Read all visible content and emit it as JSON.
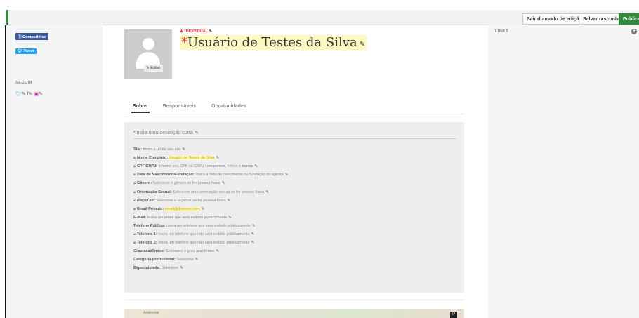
{
  "toolbar": {
    "exit_edit": "Sair do modo de edição",
    "save_draft": "Salvar rascunho",
    "publish": "Publicar"
  },
  "sidebar": {
    "share": "Compartilhar",
    "tweet": "Tweet",
    "follow_title": "SEGUIR"
  },
  "links": {
    "title": "LINKS"
  },
  "profile": {
    "type_tag": "INDIVIDUAL",
    "name": "Usuário de Testes da Silva",
    "edit_avatar": "Editar"
  },
  "tabs": [
    "Sobre",
    "Responsáveis",
    "Oportunidades"
  ],
  "description_placeholder": "Insira uma descrição curta",
  "fields": [
    {
      "label": "Site:",
      "value": "Insira a url de seu site",
      "locked": false,
      "highlight": false
    },
    {
      "label": "Nome Completo:",
      "value": "Usuário de Testes da Silva",
      "locked": true,
      "highlight": true
    },
    {
      "label": "CPF/CNPJ:",
      "value": "Informe seu CPF ou CNPJ com pontos, hífens e barras",
      "locked": true,
      "highlight": false
    },
    {
      "label": "Data de Nascimento/Fundação:",
      "value": "Insira a data de nascimento ou fundação do agente",
      "locked": true,
      "highlight": false
    },
    {
      "label": "Gênero:",
      "value": "Selecione o gênero se for pessoa física",
      "locked": true,
      "highlight": false
    },
    {
      "label": "Orientação Sexual:",
      "value": "Selecione uma orientação sexual se for pessoa física",
      "locked": true,
      "highlight": false
    },
    {
      "label": "Raça/Cor:",
      "value": "Selecione a raça/cor se for pessoa física",
      "locked": true,
      "highlight": false
    },
    {
      "label": "Email Privado:",
      "value": "email@dominio.com",
      "locked": true,
      "highlight": true
    },
    {
      "label": "E-mail:",
      "value": "Insira um email que será exibido publicamente",
      "locked": false,
      "highlight": false
    },
    {
      "label": "Telefone Público:",
      "value": "Insira um telefone que será exibido publicamente",
      "locked": false,
      "highlight": false
    },
    {
      "label": "Telefone 1:",
      "value": "Insira um telefone que não será exibido publicamente",
      "locked": true,
      "highlight": false
    },
    {
      "label": "Telefone 2:",
      "value": "Insira um telefone que não será exibido publicamente",
      "locked": true,
      "highlight": false
    },
    {
      "label": "Grau acadêmico:",
      "value": "Selecione o grau acadêmico",
      "locked": false,
      "highlight": false
    },
    {
      "label": "Categoria profissional:",
      "value": "Selecione",
      "locked": false,
      "highlight": false
    },
    {
      "label": "Especialidade:",
      "value": "Selecione",
      "locked": false,
      "highlight": false
    }
  ],
  "map": {
    "label": "Ambiental"
  },
  "colors": {
    "accent_green": "#2e8b3a",
    "required_red": "#d33333",
    "highlight_yellow": "#fdf7c0"
  }
}
